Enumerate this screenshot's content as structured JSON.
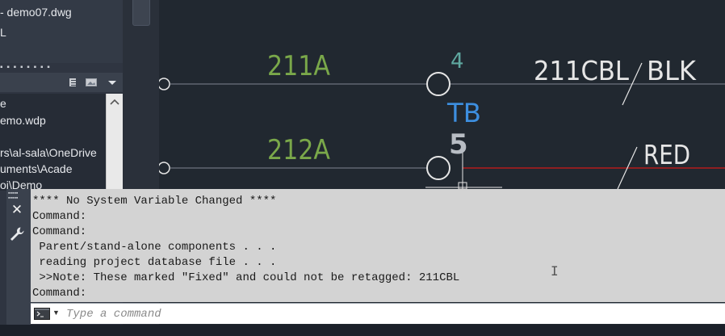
{
  "project_panel": {
    "header_lines": [
      "- demo07.dwg",
      "L"
    ],
    "tree_lines": [
      "e",
      "emo.wdp",
      "",
      "rs\\al-sala\\OneDrive",
      "uments\\Acade",
      "oi\\Demo"
    ]
  },
  "drawing": {
    "wires": [
      {
        "wire_number": "211A",
        "terminal_number": "4",
        "cable_label": "211CBL",
        "wire_color": "BLK"
      },
      {
        "wire_number": "212A",
        "terminal_number": "5",
        "wire_color": "RED"
      }
    ],
    "terminal_strip_label": "TB",
    "colors": {
      "wire_number": "#7aa84a",
      "terminal_number": "#5fa8a0",
      "tb_label": "#3d8fe0",
      "wire_line": "#7e8590",
      "red_wire": "#d01818",
      "cable_text": "#e6e6e6",
      "five_number": "#b8bdc4"
    }
  },
  "command_line": {
    "history": [
      "**** No System Variable Changed ****",
      "Command:",
      "Command:",
      " Parent/stand-alone components . . .",
      " reading project database file . . .",
      " >>Note: These marked \"Fixed\" and could not be retagged: 211CBL",
      "Command:"
    ],
    "input_placeholder": "Type a command",
    "input_value": "",
    "icons": {
      "close": "close-icon",
      "customize": "wrench-icon",
      "prompt": "command-prompt-icon"
    }
  }
}
